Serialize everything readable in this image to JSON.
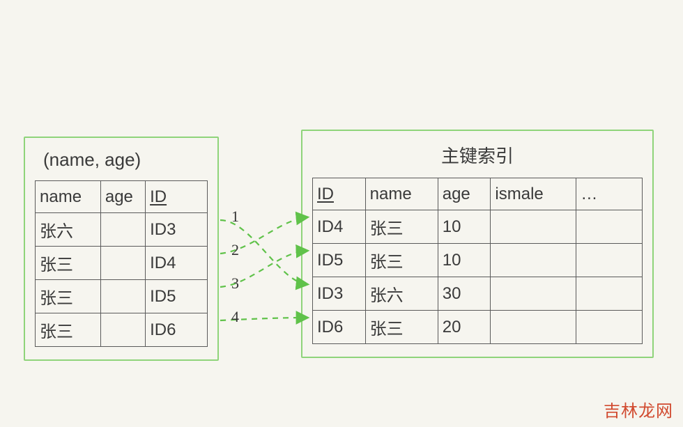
{
  "leftTable": {
    "title": "(name, age)",
    "headers": [
      "name",
      "age",
      "ID"
    ],
    "underline": [
      false,
      false,
      true
    ],
    "rows": [
      {
        "name": "张六",
        "age": "",
        "id": "ID3"
      },
      {
        "name": "张三",
        "age": "",
        "id": "ID4"
      },
      {
        "name": "张三",
        "age": "",
        "id": "ID5"
      },
      {
        "name": "张三",
        "age": "",
        "id": "ID6"
      }
    ]
  },
  "rightTable": {
    "title": "主键索引",
    "headers": [
      "ID",
      "name",
      "age",
      "ismale",
      "…"
    ],
    "underline": [
      true,
      false,
      false,
      false,
      false
    ],
    "rows": [
      {
        "id": "ID4",
        "name": "张三",
        "age": "10",
        "ismale": "",
        "etc": ""
      },
      {
        "id": "ID5",
        "name": "张三",
        "age": "10",
        "ismale": "",
        "etc": ""
      },
      {
        "id": "ID3",
        "name": "张六",
        "age": "30",
        "ismale": "",
        "etc": ""
      },
      {
        "id": "ID6",
        "name": "张三",
        "age": "20",
        "ismale": "",
        "etc": ""
      }
    ]
  },
  "arrows": {
    "labels": [
      "1",
      "2",
      "3",
      "4"
    ]
  },
  "watermark": "吉林龙网"
}
